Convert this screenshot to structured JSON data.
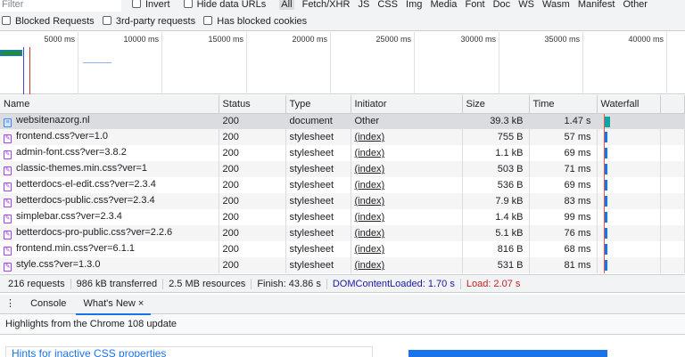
{
  "toolbar": {
    "filter_placeholder": "Filter",
    "invert": "Invert",
    "hide_data_urls": "Hide data URLs",
    "types": [
      "All",
      "Fetch/XHR",
      "JS",
      "CSS",
      "Img",
      "Media",
      "Font",
      "Doc",
      "WS",
      "Wasm",
      "Manifest",
      "Other"
    ],
    "has_blocked": "Has blocked cookies",
    "blocked_requests": "Blocked Requests",
    "third_party": "3rd-party requests"
  },
  "overview": {
    "ticks": [
      "5000 ms",
      "10000 ms",
      "15000 ms",
      "20000 ms",
      "25000 ms",
      "30000 ms",
      "35000 ms",
      "40000 ms"
    ]
  },
  "table": {
    "headers": [
      "Name",
      "Status",
      "Type",
      "Initiator",
      "Size",
      "Time",
      "Waterfall"
    ],
    "rows": [
      {
        "name": "websitenazorg.nl",
        "status": "200",
        "type": "document",
        "initiator": "Other",
        "size": "39.3 kB",
        "time": "1.47 s"
      },
      {
        "name": "frontend.css?ver=1.0",
        "status": "200",
        "type": "stylesheet",
        "initiator": "(index)",
        "size": "755 B",
        "time": "57 ms"
      },
      {
        "name": "admin-font.css?ver=3.8.2",
        "status": "200",
        "type": "stylesheet",
        "initiator": "(index)",
        "size": "1.1 kB",
        "time": "69 ms"
      },
      {
        "name": "classic-themes.min.css?ver=1",
        "status": "200",
        "type": "stylesheet",
        "initiator": "(index)",
        "size": "503 B",
        "time": "71 ms"
      },
      {
        "name": "betterdocs-el-edit.css?ver=2.3.4",
        "status": "200",
        "type": "stylesheet",
        "initiator": "(index)",
        "size": "536 B",
        "time": "69 ms"
      },
      {
        "name": "betterdocs-public.css?ver=2.3.4",
        "status": "200",
        "type": "stylesheet",
        "initiator": "(index)",
        "size": "7.9 kB",
        "time": "83 ms"
      },
      {
        "name": "simplebar.css?ver=2.3.4",
        "status": "200",
        "type": "stylesheet",
        "initiator": "(index)",
        "size": "1.4 kB",
        "time": "99 ms"
      },
      {
        "name": "betterdocs-pro-public.css?ver=2.2.6",
        "status": "200",
        "type": "stylesheet",
        "initiator": "(index)",
        "size": "5.1 kB",
        "time": "76 ms"
      },
      {
        "name": "frontend.min.css?ver=6.1.1",
        "status": "200",
        "type": "stylesheet",
        "initiator": "(index)",
        "size": "816 B",
        "time": "68 ms"
      },
      {
        "name": "style.css?ver=1.3.0",
        "status": "200",
        "type": "stylesheet",
        "initiator": "(index)",
        "size": "531 B",
        "time": "81 ms"
      }
    ]
  },
  "status": {
    "requests": "216 requests",
    "transferred": "986 kB transferred",
    "resources": "2.5 MB resources",
    "finish": "Finish: 43.86 s",
    "dcl": "DOMContentLoaded: 1.70 s",
    "load": "Load: 2.07 s"
  },
  "drawer": {
    "tabs": [
      "Console",
      "What's New"
    ],
    "close": "×",
    "highlights": "Highlights from the Chrome 108 update",
    "card_title": "Hints for inactive CSS properties"
  }
}
